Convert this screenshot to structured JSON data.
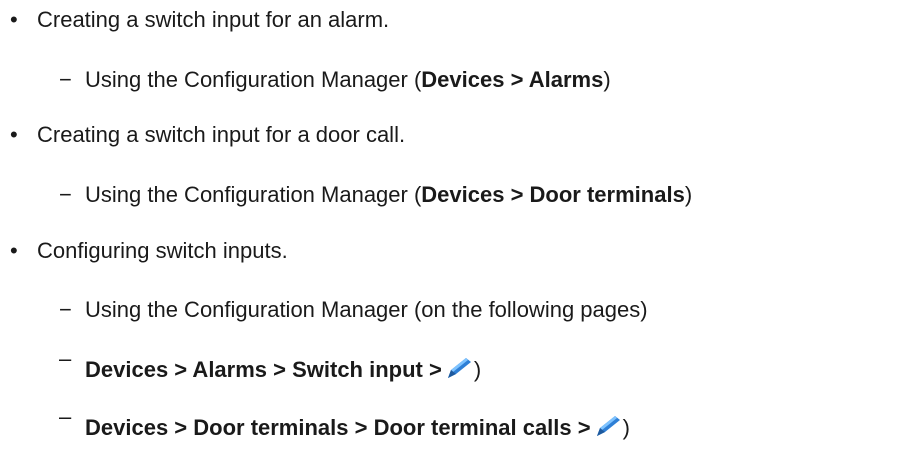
{
  "items": [
    {
      "text": "Creating a switch input for an alarm.",
      "sub": {
        "prefix": "Using the Configuration Manager (",
        "bold": "Devices > Alarms",
        "suffix": ")"
      }
    },
    {
      "text": "Creating a switch input for a door call.",
      "sub": {
        "prefix": "Using the Configuration Manager (",
        "bold": "Devices > Door terminals",
        "suffix": ")"
      }
    },
    {
      "text": "Configuring switch inputs.",
      "sub": {
        "text": "Using the Configuration Manager (on the following pages)"
      },
      "paths": [
        {
          "bold": "Devices > Alarms > Switch input >",
          "icon": "pencil-icon",
          "suffix": ")"
        },
        {
          "bold": "Devices > Door terminals > Door terminal calls >",
          "icon": "pencil-icon",
          "suffix": ")"
        }
      ]
    }
  ],
  "markers": {
    "bullet": "•",
    "dash": "−",
    "dash_short": "–"
  },
  "colors": {
    "text": "#1a1a1a",
    "pencil_blue": "#2e7fd6",
    "pencil_light": "#7ec3ff"
  }
}
